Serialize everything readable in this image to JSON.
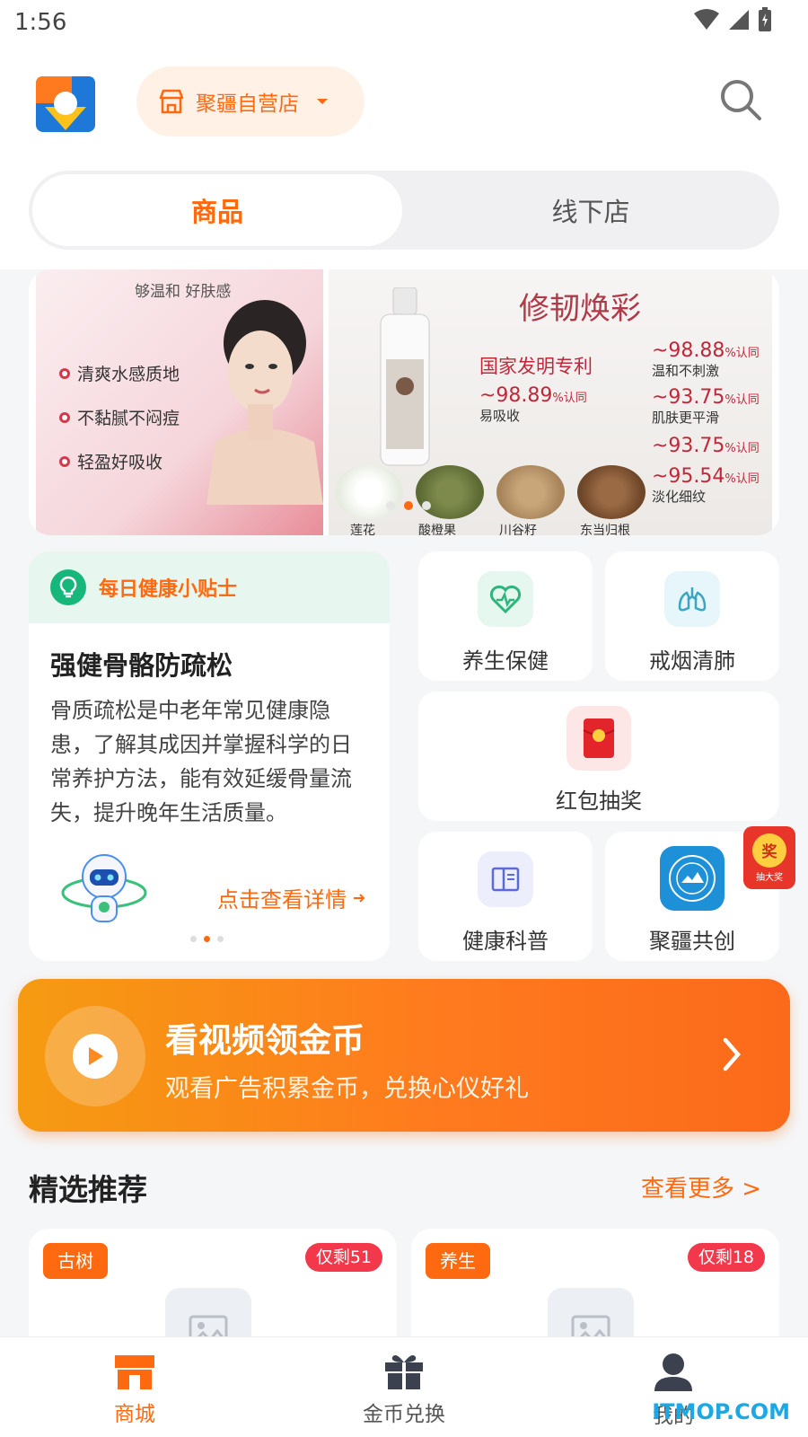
{
  "status_bar": {
    "time": "1:56"
  },
  "header": {
    "store_name": "聚疆自营店",
    "segments": {
      "active": "商品",
      "inactive": "线下店"
    }
  },
  "banner": {
    "left_subtitle": "够温和 好肤感",
    "left_bullets": [
      "清爽水感质地",
      "不黏腻不闷痘",
      "轻盈好吸收"
    ],
    "right_title": "修韧焕彩",
    "patent": "国家发明专利",
    "stats": [
      {
        "value": "~98.89",
        "pct": "%认同",
        "desc": "易吸收"
      },
      {
        "value": "~98.88",
        "pct": "%认同",
        "desc": "温和不刺激"
      },
      {
        "value": "~93.75",
        "pct": "%认同",
        "desc": "肌肤更平滑"
      },
      {
        "value": "~93.75",
        "pct": "%认同",
        "desc": ""
      },
      {
        "value": "~95.54",
        "pct": "%认同",
        "desc": "淡化细纹"
      }
    ],
    "herbs": [
      "莲花",
      "酸橙果",
      "川谷籽",
      "东当归根"
    ],
    "carousel_count": 3,
    "carousel_active": 2
  },
  "tip_card": {
    "header": "每日健康小贴士",
    "title": "强健骨骼防疏松",
    "body": "骨质疏松是中老年常见健康隐患，了解其成因并掌握科学的日常养护方法，能有效延缓骨量流失，提升晚年生活质量。",
    "link": "点击查看详情",
    "dots_count": 3,
    "dots_active": 2
  },
  "tiles": {
    "health": "养生保健",
    "lung": "戒烟清肺",
    "redpacket": "红包抽奖",
    "science": "健康科普",
    "cocreate": "聚疆共创"
  },
  "prize_badge": {
    "coin": "奖",
    "text": "抽大奖"
  },
  "video_banner": {
    "title": "看视频领金币",
    "subtitle": "观看广告积累金币，兑换心仪好礼"
  },
  "section": {
    "title": "精选推荐",
    "more": "查看更多 >"
  },
  "products": [
    {
      "tag": "古树",
      "stock": "仅剩51"
    },
    {
      "tag": "养生",
      "stock": "仅剩18"
    }
  ],
  "tabbar": {
    "items": [
      {
        "label": "商城",
        "active": true
      },
      {
        "label": "金币兑换",
        "active": false
      },
      {
        "label": "我的",
        "active": false
      }
    ]
  },
  "watermark": "ITMOP.COM",
  "colors": {
    "accent": "#ff6a10",
    "green": "#17b67a",
    "red": "#f2384a"
  }
}
